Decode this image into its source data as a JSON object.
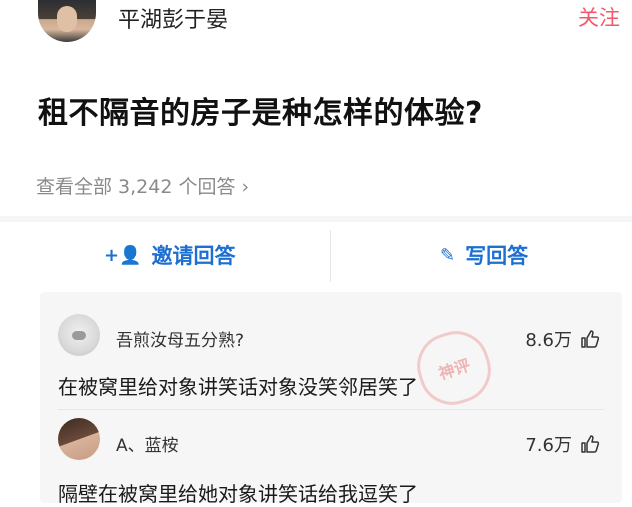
{
  "header": {
    "author_name": "平湖彭于晏",
    "follow_label": "关注"
  },
  "question": {
    "title": "租不隔音的房子是种怎样的体验?",
    "view_all": "查看全部 3,242 个回答 ›"
  },
  "actions": {
    "invite_icon": "+👤",
    "invite_label": "邀请回答",
    "write_icon": "✎",
    "write_label": "写回答"
  },
  "comments": [
    {
      "name": "吾煎汝母五分熟?",
      "likes": "8.6万",
      "text": "在被窝里给对象讲笑话对象没笑邻居笑了"
    },
    {
      "name": "A、蓝桉",
      "likes": "7.6万",
      "text": "隔壁在被窝里给她对象讲笑话给我逗笑了"
    }
  ],
  "watermark": {
    "stamp_text": "神评"
  },
  "icons": {
    "thumb": "thumbs-up-icon",
    "invite": "add-user-icon",
    "write": "edit-icon"
  },
  "colors": {
    "accent_blue": "#1d6fd1",
    "follow_red": "#f05a6a",
    "muted_gray": "#8a8a8a"
  }
}
